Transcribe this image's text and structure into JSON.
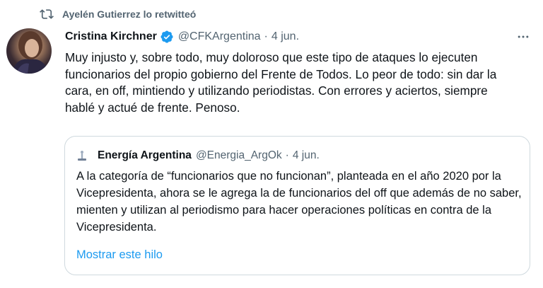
{
  "retweet": {
    "icon": "retweet-icon",
    "label": "Ayelén Gutierrez lo retwitteó"
  },
  "tweet": {
    "author_name": "Cristina Kirchner",
    "verified_icon": "verified-badge-icon",
    "handle": "@CFKArgentina",
    "separator": "·",
    "date": "4 jun.",
    "more_icon": "more-options-icon",
    "text": "Muy injusto y, sobre todo, muy doloroso que este tipo de ataques lo ejecuten funcionarios del propio gobierno del Frente de Todos. Lo peor de todo: sin dar la cara, en off, mintiendo y utilizando periodistas. Con errores y aciertos, siempre hablé y actué de frente. Penoso."
  },
  "quote": {
    "author_name": "Energía Argentina",
    "handle": "@Energia_ArgOk",
    "separator": "·",
    "date": "4 jun.",
    "text": "A la categoría de “funcionarios que no funcionan”, planteada en el año 2020 por la Vicepresidenta, ahora se le agrega la de funcionarios del off que además de no saber, mienten y utilizan al periodismo para hacer operaciones políticas en contra de la Vicepresidenta.",
    "show_thread": "Mostrar este hilo"
  },
  "colors": {
    "text": "#0f1419",
    "secondary": "#536471",
    "accent": "#1d9bf0",
    "border": "#cfd9de"
  }
}
